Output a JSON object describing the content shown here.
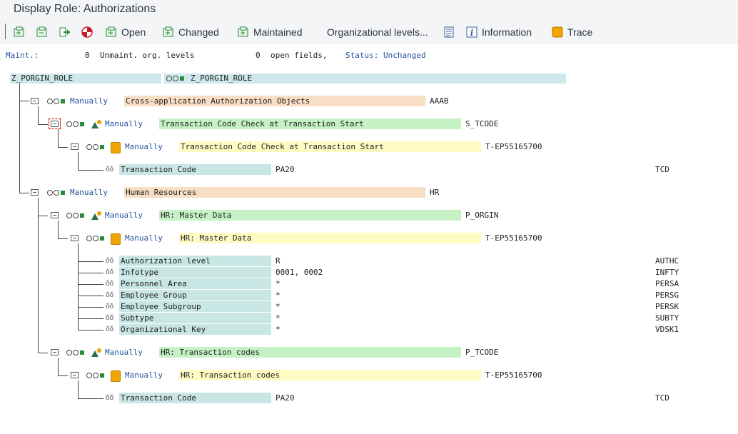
{
  "window": {
    "title": "Display Role: Authorizations"
  },
  "toolbar": {
    "buttons": [
      {
        "label": "",
        "icon": "expand-all-icon"
      },
      {
        "label": "",
        "icon": "collapse-all-icon"
      },
      {
        "label": "",
        "icon": "navigate-icon"
      },
      {
        "label": "",
        "icon": "deactivate-icon"
      },
      {
        "label": "Open",
        "icon": "open-node-icon"
      },
      {
        "label": "Changed",
        "icon": "changed-node-icon"
      },
      {
        "label": "Maintained",
        "icon": "maintained-node-icon"
      },
      {
        "label": "Organizational levels...",
        "icon": ""
      },
      {
        "label": "",
        "icon": "list-icon"
      },
      {
        "label": "Information",
        "icon": "info-icon"
      },
      {
        "label": "Trace",
        "icon": "trace-icon"
      }
    ]
  },
  "status": {
    "maint_label": "Maint.:",
    "maint_count": "0",
    "unmaint_label": "Unmaint. org. levels",
    "open_count": "0",
    "open_label": "open fields,",
    "status_label": "Status: Unchanged"
  },
  "tree": {
    "root_left": "Z_PORGIN_ROLE",
    "root_right": "Z_PORGIN_ROLE",
    "nodes": [
      {
        "mode": "Manually",
        "text": "Cross-application Authorization Objects",
        "code": "AAAB"
      },
      {
        "mode": "Manually",
        "text": "Transaction Code Check at Transaction Start",
        "code": "S_TCODE"
      },
      {
        "mode": "Manually",
        "text": "Transaction Code Check at Transaction Start",
        "code": "T-EP55165700"
      },
      {
        "mode": "Manually",
        "text": "Human Resources",
        "code": "HR"
      },
      {
        "mode": "Manually",
        "text": "HR: Master Data",
        "code": "P_ORGIN"
      },
      {
        "mode": "Manually",
        "text": "HR: Master Data",
        "code": "T-EP55165700"
      },
      {
        "mode": "Manually",
        "text": "HR: Transaction codes",
        "code": "P_TCODE"
      },
      {
        "mode": "Manually",
        "text": "HR: Transaction codes",
        "code": "T-EP55165700"
      }
    ],
    "fields": [
      {
        "label": "Transaction Code",
        "value": "PA20",
        "code": "TCD"
      },
      {
        "label": "Authorization level",
        "value": "R",
        "code": "AUTHC"
      },
      {
        "label": "Infotype",
        "value": "0001, 0002",
        "code": "INFTY"
      },
      {
        "label": "Personnel Area",
        "value": "*",
        "code": "PERSA"
      },
      {
        "label": "Employee Group",
        "value": "*",
        "code": "PERSG"
      },
      {
        "label": "Employee Subgroup",
        "value": "*",
        "code": "PERSK"
      },
      {
        "label": "Subtype",
        "value": "*",
        "code": "SUBTY"
      },
      {
        "label": "Organizational Key",
        "value": "*",
        "code": "VDSK1"
      },
      {
        "label": "Transaction Code",
        "value": "PA20",
        "code": "TCD"
      }
    ]
  }
}
